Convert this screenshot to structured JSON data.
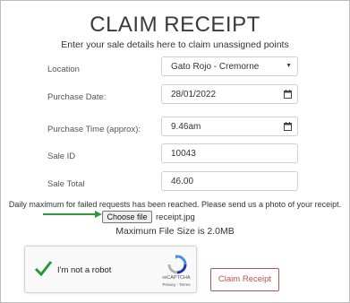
{
  "header": {
    "title": "CLAIM RECEIPT",
    "subtitle": "Enter your sale details here to claim unassigned points"
  },
  "form": {
    "location": {
      "label": "Location",
      "value": "Gato Rojo - Cremorne"
    },
    "purchase_date": {
      "label": "Purchase Date:",
      "value": "28/01/2022"
    },
    "purchase_time": {
      "label": "Purchase Time (approx):",
      "value": "9.46am"
    },
    "sale_id": {
      "label": "Sale ID",
      "value": "10043"
    },
    "sale_total": {
      "label": "Sale Total",
      "value": "46.00"
    }
  },
  "upload": {
    "notice": "Daily maximum for failed requests has been reached. Please send us a photo of your receipt.",
    "choose_file_label": "Choose file",
    "file_name": "receipt.jpg",
    "max_size": "Maximum File Size is 2.0MB"
  },
  "captcha": {
    "label": "I'm not a robot",
    "brand": "reCAPTCHA",
    "links": "Privacy - Terms"
  },
  "actions": {
    "claim_label": "Claim Receipt"
  },
  "colors": {
    "accent": "#b9534f",
    "arrow": "#2e9a3a",
    "check": "#1f9d3a"
  }
}
